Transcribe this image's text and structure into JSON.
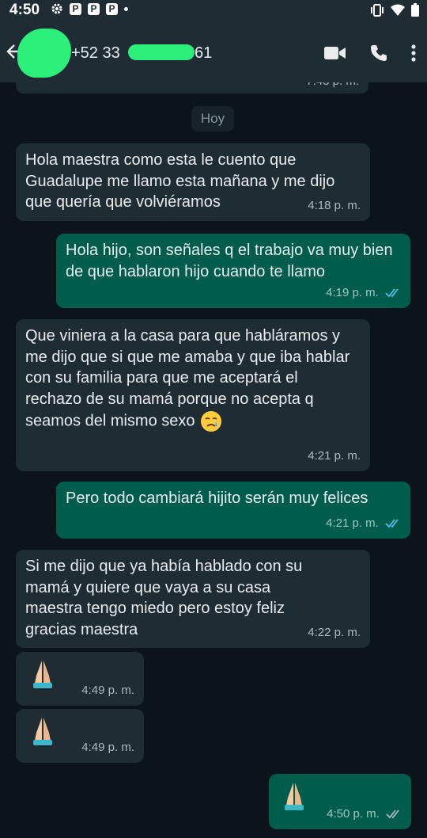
{
  "status": {
    "time": "4:50"
  },
  "header": {
    "contact_prefix": "+52 33",
    "contact_suffix": "61"
  },
  "chat": {
    "top_fragment_time": "7:43 p. m.",
    "date_chip": "Hoy",
    "messages": [
      {
        "dir": "in",
        "text": "Hola maestra como esta le cuento que Guadalupe me llamo esta mañana y me dijo que quería que volviéramos",
        "time": "4:18 p. m."
      },
      {
        "dir": "out",
        "text": "Hola hijo, son señales q el trabajo va muy bien de que hablaron hijo cuando te llamo",
        "time": "4:19 p. m."
      },
      {
        "dir": "in",
        "text": "Que viniera a la casa para que habláramos y me dijo que si que me amaba y que iba hablar con su familia para que me aceptará el rechazo de su mamá porque no acepta q seamos del mismo sexo",
        "emoji": "crying-face-emoji",
        "time": "4:21 p. m."
      },
      {
        "dir": "out",
        "text": "Pero todo cambiará hijito serán muy felices",
        "time": "4:21 p. m."
      },
      {
        "dir": "in",
        "text": "Si me dijo que ya había hablado con su mamá y quiere que vaya a su casa maestra tengo miedo pero estoy feliz gracias maestra",
        "time": "4:22 p. m."
      },
      {
        "dir": "in",
        "emoji": "folded-hands-emoji",
        "time": "4:49 p. m."
      },
      {
        "dir": "in",
        "emoji": "folded-hands-emoji",
        "time": "4:49 p. m."
      },
      {
        "dir": "out",
        "emoji": "folded-hands-emoji",
        "time": "4:50 p. m."
      }
    ]
  },
  "colors": {
    "header_bg": "#1f2c34",
    "chat_bg": "#0b141a",
    "incoming_bubble": "#1f2c34",
    "outgoing_bubble": "#005c4b",
    "read_ticks": "#53bdeb",
    "redaction": "#2cf07a"
  }
}
